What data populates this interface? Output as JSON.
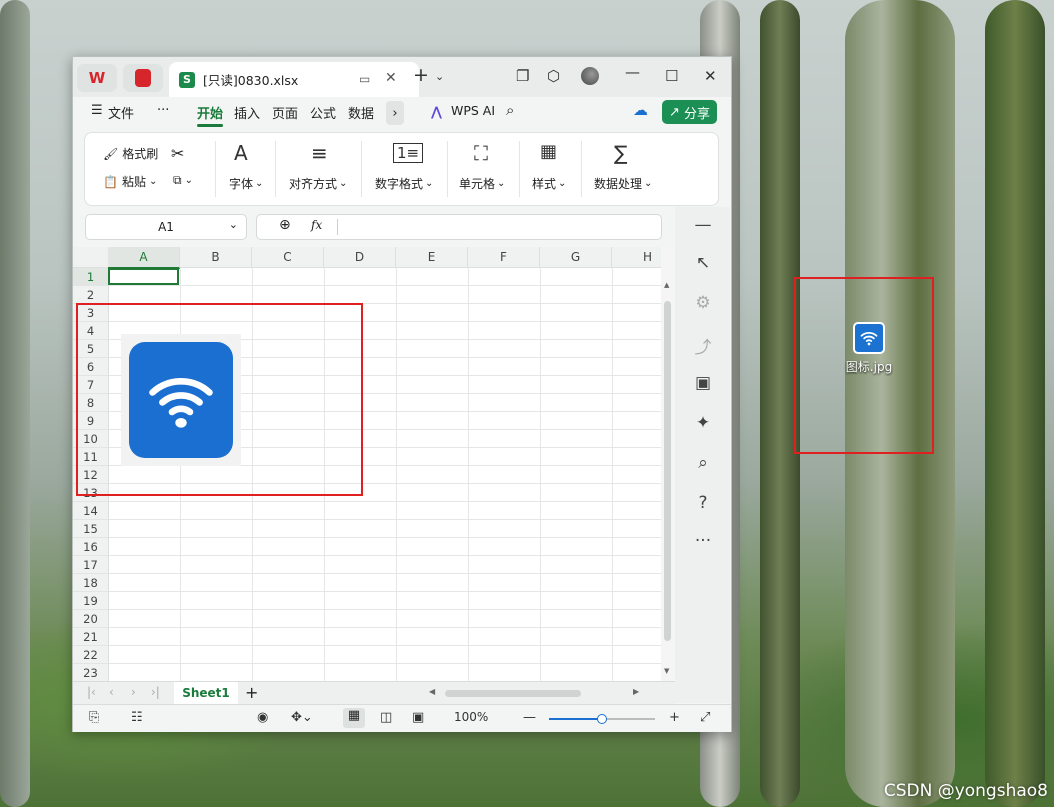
{
  "window": {
    "tab_title": "[只读]0830.xlsx",
    "tab_badge": "S"
  },
  "menubar": {
    "file": "文件",
    "more": "···",
    "items": [
      "开始",
      "插入",
      "页面",
      "公式",
      "数据"
    ],
    "wps_ai": "WPS AI",
    "share": "分享"
  },
  "ribbon": {
    "format_painter": "格式刷",
    "paste": "粘贴",
    "font": "字体",
    "align": "对齐方式",
    "number_format": "数字格式",
    "cell": "单元格",
    "style": "样式",
    "data_process": "数据处理"
  },
  "formula": {
    "name_box": "A1",
    "fx": "fx",
    "content": ""
  },
  "grid": {
    "columns": [
      "A",
      "B",
      "C",
      "D",
      "E",
      "F",
      "G",
      "H"
    ],
    "rows": [
      "1",
      "2",
      "3",
      "4",
      "5",
      "6",
      "7",
      "8",
      "9",
      "10",
      "11",
      "12",
      "13",
      "14",
      "15",
      "16",
      "17",
      "18",
      "19",
      "20",
      "21",
      "22",
      "23"
    ]
  },
  "sheetbar": {
    "sheet": "Sheet1",
    "add": "+"
  },
  "statusbar": {
    "zoom": "100%",
    "zoom_level": 100
  },
  "desktop": {
    "file_label": "图标.jpg"
  },
  "watermark": "CSDN @yongshao8",
  "colors": {
    "accent_green": "#1a7a3c",
    "share_green": "#1b8f54",
    "icon_blue": "#1b6fd0",
    "annotation_red": "#e02020"
  }
}
